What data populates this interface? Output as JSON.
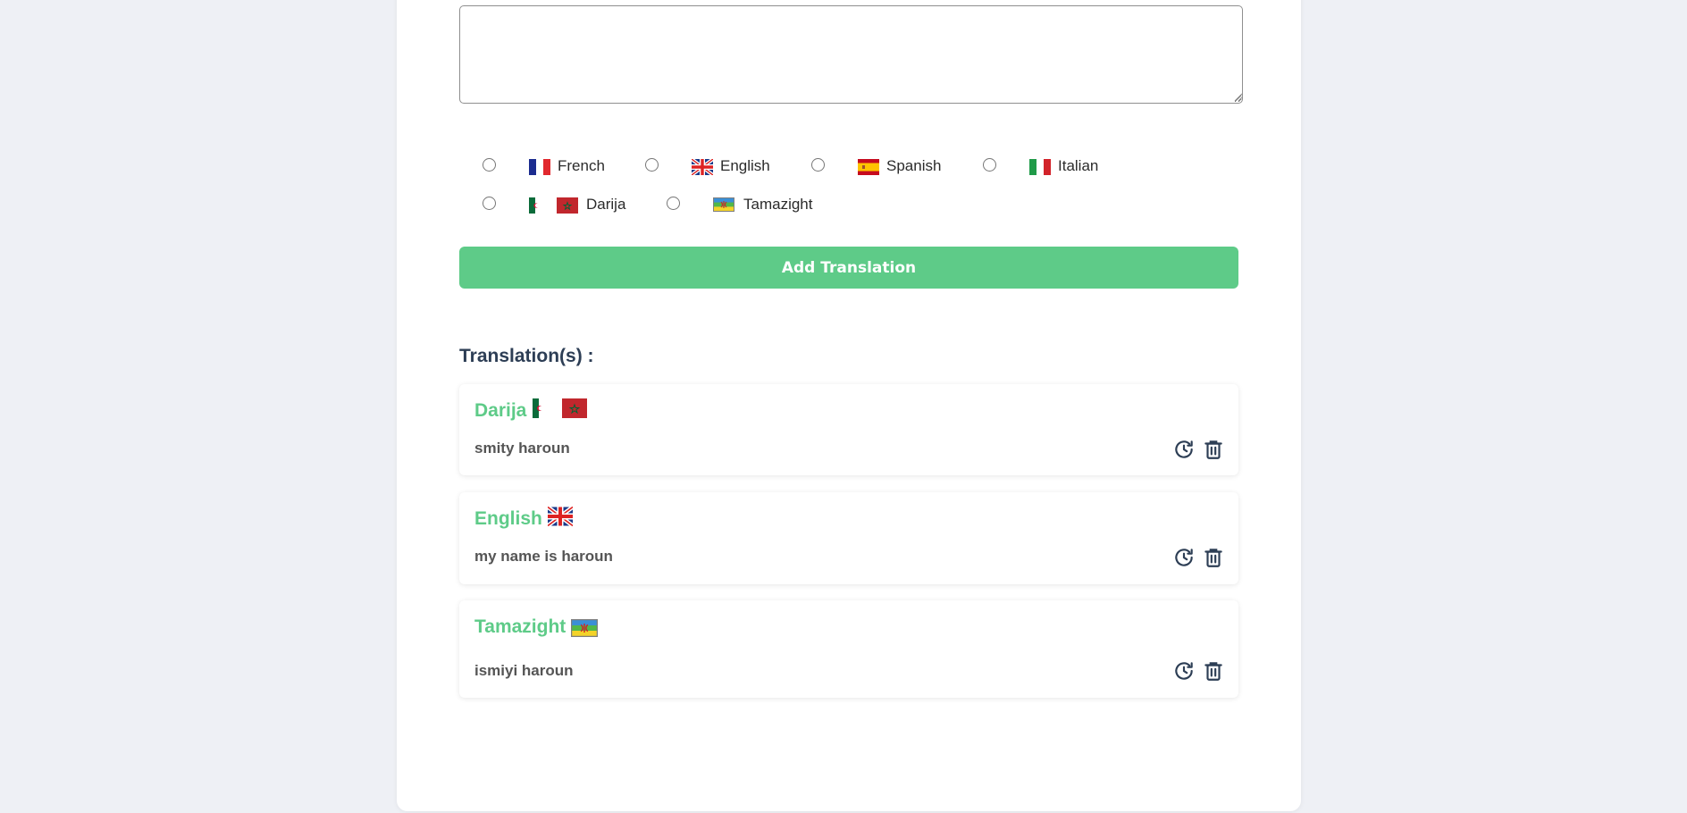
{
  "form": {
    "text_value": "",
    "languages": [
      {
        "label": "French",
        "flag": "france-flag-icon"
      },
      {
        "label": "English",
        "flag": "uk-flag-icon"
      },
      {
        "label": "Spanish",
        "flag": "spain-flag-icon"
      },
      {
        "label": "Italian",
        "flag": "italy-flag-icon"
      },
      {
        "label": "Darija",
        "flag": "darija-flags-icon"
      },
      {
        "label": "Tamazight",
        "flag": "amazigh-flag-icon"
      }
    ],
    "add_button_label": "Add Translation"
  },
  "translations": {
    "title": "Translation(s) :",
    "items": [
      {
        "language": "Darija",
        "text": "smity haroun",
        "flag": "darija-flags-icon"
      },
      {
        "language": "English",
        "text": "my name is haroun",
        "flag": "uk-flag-icon"
      },
      {
        "language": "Tamazight",
        "text": "ismiyi haroun",
        "flag": "amazigh-flag-icon"
      }
    ]
  },
  "colors": {
    "accent": "#5ecb88",
    "heading": "#2d3e55",
    "background": "#eef0f5"
  }
}
